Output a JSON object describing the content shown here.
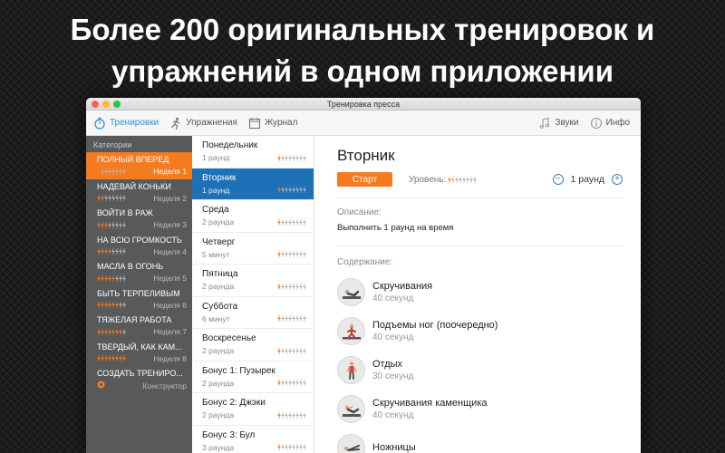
{
  "headline": {
    "line1": "Более 200 оригинальных тренировок и",
    "line2": "упражнений в одном приложении"
  },
  "window": {
    "title": "Тренировка пресса"
  },
  "toolbar": {
    "workouts": "Тренировки",
    "exercises": "Упражнения",
    "journal": "Журнал",
    "sounds": "Звуки",
    "info": "Инфо"
  },
  "sidebar": {
    "header": "Категории",
    "items": [
      {
        "title": "ПОЛНЫЙ ВПЕРЕД",
        "week": "Неделя 1",
        "level": 1
      },
      {
        "title": "НАДЕВАЙ КОНЬКИ",
        "week": "Неделя 2",
        "level": 2
      },
      {
        "title": "ВОЙТИ В РАЖ",
        "week": "Неделя 3",
        "level": 3
      },
      {
        "title": "НА ВСЮ ГРОМКОСТЬ",
        "week": "Неделя 4",
        "level": 4
      },
      {
        "title": "МАСЛА В ОГОНЬ",
        "week": "Неделя 5",
        "level": 5
      },
      {
        "title": "БЫТЬ ТЕРПЕЛИВЫМ",
        "week": "Неделя 6",
        "level": 6
      },
      {
        "title": "ТЯЖЕЛАЯ РАБОТА",
        "week": "Неделя 7",
        "level": 7
      },
      {
        "title": "ТВЕРДЫЙ, КАК КАМ...",
        "week": "Неделя 8",
        "level": 8
      },
      {
        "title": "СОЗДАТЬ ТРЕНИРО...",
        "week": "Конструктор",
        "level": 0
      }
    ]
  },
  "days": {
    "items": [
      {
        "name": "Понедельник",
        "sub": "1 раунд",
        "level": 1
      },
      {
        "name": "Вторник",
        "sub": "1 раунд",
        "level": 1
      },
      {
        "name": "Среда",
        "sub": "2 раунда",
        "level": 1
      },
      {
        "name": "Четверг",
        "sub": "5 минут",
        "level": 1
      },
      {
        "name": "Пятница",
        "sub": "2 раунда",
        "level": 1
      },
      {
        "name": "Суббота",
        "sub": "6 минут",
        "level": 1
      },
      {
        "name": "Воскресенье",
        "sub": "2 раунда",
        "level": 1
      },
      {
        "name": "Бонус 1: Пузырек",
        "sub": "2 раунда",
        "level": 1
      },
      {
        "name": "Бонус 2: Джэки",
        "sub": "2 раунда",
        "level": 1
      },
      {
        "name": "Бонус 3: Бул",
        "sub": "3 раунда",
        "level": 1
      }
    ]
  },
  "detail": {
    "title": "Вторник",
    "start": "Старт",
    "level_label": "Уровень:",
    "level": 1,
    "rounds": "1 раунд",
    "description_label": "Описание:",
    "description": "Выполнить 1 раунд на время",
    "contents_label": "Содержание:",
    "exercises": [
      {
        "name": "Скручивания",
        "duration": "40 секунд"
      },
      {
        "name": "Подъемы ног (поочередно)",
        "duration": "40 секунд"
      },
      {
        "name": "Отдых",
        "duration": "30 секунд"
      },
      {
        "name": "Скручивания каменщика",
        "duration": "40 секунд"
      },
      {
        "name": "Ножницы",
        "duration": ""
      }
    ]
  },
  "colors": {
    "accent": "#f57b20",
    "selected": "#1e70b7",
    "sidebar_bg": "#58595b",
    "link": "#2f8fd0"
  }
}
